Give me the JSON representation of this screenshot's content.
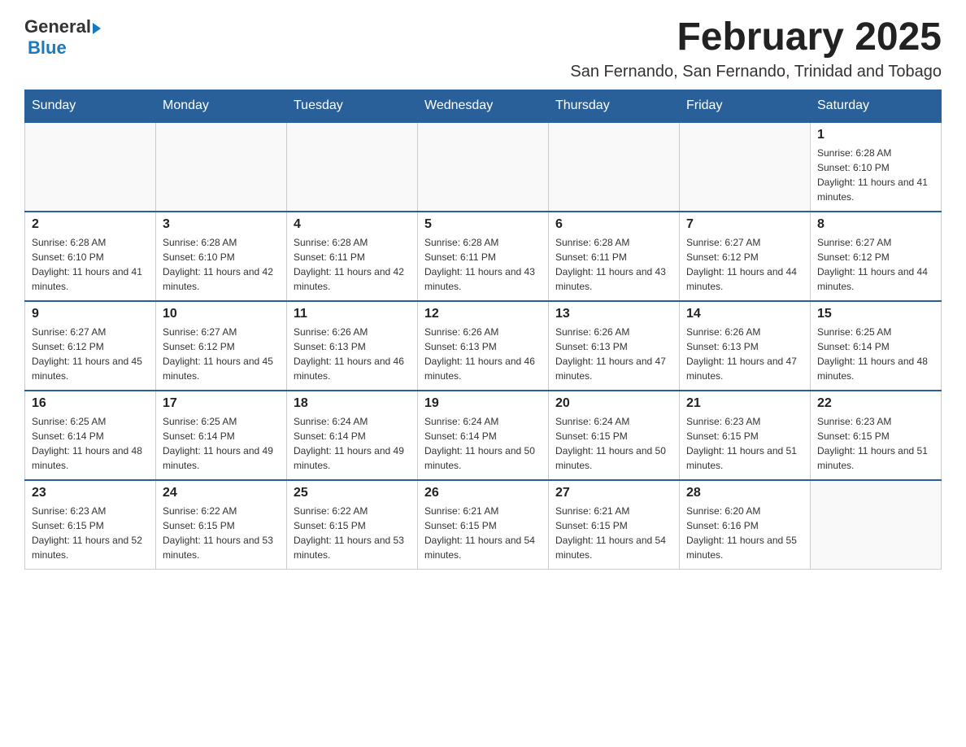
{
  "header": {
    "logo": {
      "text_general": "General",
      "text_blue": "Blue",
      "aria": "GeneralBlue logo"
    },
    "month_title": "February 2025",
    "location": "San Fernando, San Fernando, Trinidad and Tobago"
  },
  "calendar": {
    "days_of_week": [
      "Sunday",
      "Monday",
      "Tuesday",
      "Wednesday",
      "Thursday",
      "Friday",
      "Saturday"
    ],
    "weeks": [
      [
        {
          "day": "",
          "info": ""
        },
        {
          "day": "",
          "info": ""
        },
        {
          "day": "",
          "info": ""
        },
        {
          "day": "",
          "info": ""
        },
        {
          "day": "",
          "info": ""
        },
        {
          "day": "",
          "info": ""
        },
        {
          "day": "1",
          "info": "Sunrise: 6:28 AM\nSunset: 6:10 PM\nDaylight: 11 hours and 41 minutes."
        }
      ],
      [
        {
          "day": "2",
          "info": "Sunrise: 6:28 AM\nSunset: 6:10 PM\nDaylight: 11 hours and 41 minutes."
        },
        {
          "day": "3",
          "info": "Sunrise: 6:28 AM\nSunset: 6:10 PM\nDaylight: 11 hours and 42 minutes."
        },
        {
          "day": "4",
          "info": "Sunrise: 6:28 AM\nSunset: 6:11 PM\nDaylight: 11 hours and 42 minutes."
        },
        {
          "day": "5",
          "info": "Sunrise: 6:28 AM\nSunset: 6:11 PM\nDaylight: 11 hours and 43 minutes."
        },
        {
          "day": "6",
          "info": "Sunrise: 6:28 AM\nSunset: 6:11 PM\nDaylight: 11 hours and 43 minutes."
        },
        {
          "day": "7",
          "info": "Sunrise: 6:27 AM\nSunset: 6:12 PM\nDaylight: 11 hours and 44 minutes."
        },
        {
          "day": "8",
          "info": "Sunrise: 6:27 AM\nSunset: 6:12 PM\nDaylight: 11 hours and 44 minutes."
        }
      ],
      [
        {
          "day": "9",
          "info": "Sunrise: 6:27 AM\nSunset: 6:12 PM\nDaylight: 11 hours and 45 minutes."
        },
        {
          "day": "10",
          "info": "Sunrise: 6:27 AM\nSunset: 6:12 PM\nDaylight: 11 hours and 45 minutes."
        },
        {
          "day": "11",
          "info": "Sunrise: 6:26 AM\nSunset: 6:13 PM\nDaylight: 11 hours and 46 minutes."
        },
        {
          "day": "12",
          "info": "Sunrise: 6:26 AM\nSunset: 6:13 PM\nDaylight: 11 hours and 46 minutes."
        },
        {
          "day": "13",
          "info": "Sunrise: 6:26 AM\nSunset: 6:13 PM\nDaylight: 11 hours and 47 minutes."
        },
        {
          "day": "14",
          "info": "Sunrise: 6:26 AM\nSunset: 6:13 PM\nDaylight: 11 hours and 47 minutes."
        },
        {
          "day": "15",
          "info": "Sunrise: 6:25 AM\nSunset: 6:14 PM\nDaylight: 11 hours and 48 minutes."
        }
      ],
      [
        {
          "day": "16",
          "info": "Sunrise: 6:25 AM\nSunset: 6:14 PM\nDaylight: 11 hours and 48 minutes."
        },
        {
          "day": "17",
          "info": "Sunrise: 6:25 AM\nSunset: 6:14 PM\nDaylight: 11 hours and 49 minutes."
        },
        {
          "day": "18",
          "info": "Sunrise: 6:24 AM\nSunset: 6:14 PM\nDaylight: 11 hours and 49 minutes."
        },
        {
          "day": "19",
          "info": "Sunrise: 6:24 AM\nSunset: 6:14 PM\nDaylight: 11 hours and 50 minutes."
        },
        {
          "day": "20",
          "info": "Sunrise: 6:24 AM\nSunset: 6:15 PM\nDaylight: 11 hours and 50 minutes."
        },
        {
          "day": "21",
          "info": "Sunrise: 6:23 AM\nSunset: 6:15 PM\nDaylight: 11 hours and 51 minutes."
        },
        {
          "day": "22",
          "info": "Sunrise: 6:23 AM\nSunset: 6:15 PM\nDaylight: 11 hours and 51 minutes."
        }
      ],
      [
        {
          "day": "23",
          "info": "Sunrise: 6:23 AM\nSunset: 6:15 PM\nDaylight: 11 hours and 52 minutes."
        },
        {
          "day": "24",
          "info": "Sunrise: 6:22 AM\nSunset: 6:15 PM\nDaylight: 11 hours and 53 minutes."
        },
        {
          "day": "25",
          "info": "Sunrise: 6:22 AM\nSunset: 6:15 PM\nDaylight: 11 hours and 53 minutes."
        },
        {
          "day": "26",
          "info": "Sunrise: 6:21 AM\nSunset: 6:15 PM\nDaylight: 11 hours and 54 minutes."
        },
        {
          "day": "27",
          "info": "Sunrise: 6:21 AM\nSunset: 6:15 PM\nDaylight: 11 hours and 54 minutes."
        },
        {
          "day": "28",
          "info": "Sunrise: 6:20 AM\nSunset: 6:16 PM\nDaylight: 11 hours and 55 minutes."
        },
        {
          "day": "",
          "info": ""
        }
      ]
    ]
  }
}
